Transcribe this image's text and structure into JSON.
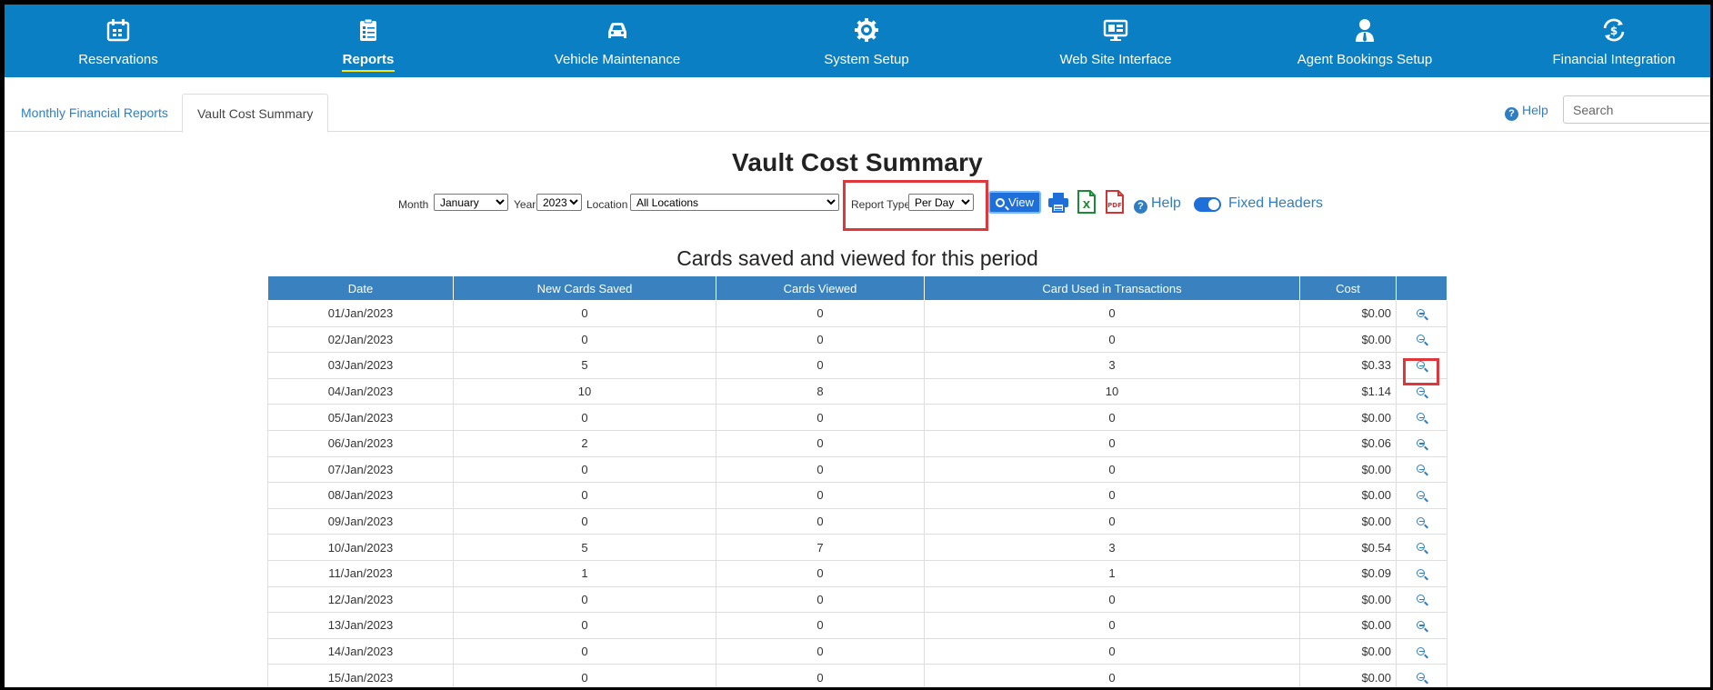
{
  "nav": [
    {
      "label": "Reservations",
      "icon": "calendar-icon",
      "active": false
    },
    {
      "label": "Reports",
      "icon": "clipboard-list-icon",
      "active": true
    },
    {
      "label": "Vehicle Maintenance",
      "icon": "car-icon",
      "active": false
    },
    {
      "label": "System Setup",
      "icon": "gear-icon",
      "active": false
    },
    {
      "label": "Web Site Interface",
      "icon": "monitor-icon",
      "active": false
    },
    {
      "label": "Agent Bookings Setup",
      "icon": "agent-icon",
      "active": false
    },
    {
      "label": "Financial Integration",
      "icon": "dollar-sync-icon",
      "active": false
    }
  ],
  "tabs": {
    "monthly": "Monthly Financial Reports",
    "vault": "Vault Cost Summary",
    "help": "Help",
    "search_placeholder": "Search"
  },
  "page_title": "Vault Cost Summary",
  "filters": {
    "month_label": "Month",
    "month_value": "January",
    "year_label": "Year",
    "year_value": "2023",
    "location_label": "Location",
    "location_value": "All Locations",
    "report_type_label": "Report Type",
    "report_type_value": "Per Day",
    "view_label": "View",
    "help_label": "Help",
    "fixed_headers_label": "Fixed Headers",
    "fixed_headers_on": true
  },
  "subtitle": "Cards saved and viewed for this period",
  "table": {
    "headers": [
      "Date",
      "New Cards Saved",
      "Cards Viewed",
      "Card Used in Transactions",
      "Cost",
      ""
    ],
    "rows": [
      [
        "01/Jan/2023",
        "0",
        "0",
        "0",
        "$0.00"
      ],
      [
        "02/Jan/2023",
        "0",
        "0",
        "0",
        "$0.00"
      ],
      [
        "03/Jan/2023",
        "5",
        "0",
        "3",
        "$0.33"
      ],
      [
        "04/Jan/2023",
        "10",
        "8",
        "10",
        "$1.14"
      ],
      [
        "05/Jan/2023",
        "0",
        "0",
        "0",
        "$0.00"
      ],
      [
        "06/Jan/2023",
        "2",
        "0",
        "0",
        "$0.06"
      ],
      [
        "07/Jan/2023",
        "0",
        "0",
        "0",
        "$0.00"
      ],
      [
        "08/Jan/2023",
        "0",
        "0",
        "0",
        "$0.00"
      ],
      [
        "09/Jan/2023",
        "0",
        "0",
        "0",
        "$0.00"
      ],
      [
        "10/Jan/2023",
        "5",
        "7",
        "3",
        "$0.54"
      ],
      [
        "11/Jan/2023",
        "1",
        "0",
        "1",
        "$0.09"
      ],
      [
        "12/Jan/2023",
        "0",
        "0",
        "0",
        "$0.00"
      ],
      [
        "13/Jan/2023",
        "0",
        "0",
        "0",
        "$0.00"
      ],
      [
        "14/Jan/2023",
        "0",
        "0",
        "0",
        "$0.00"
      ],
      [
        "15/Jan/2023",
        "0",
        "0",
        "0",
        "$0.00"
      ]
    ]
  },
  "colors": {
    "nav_bg": "#0b7fc4",
    "accent": "#2f7ec4",
    "header_bg": "#3a81c0",
    "highlight": "#e0373a",
    "active_underline": "#ffe600"
  }
}
